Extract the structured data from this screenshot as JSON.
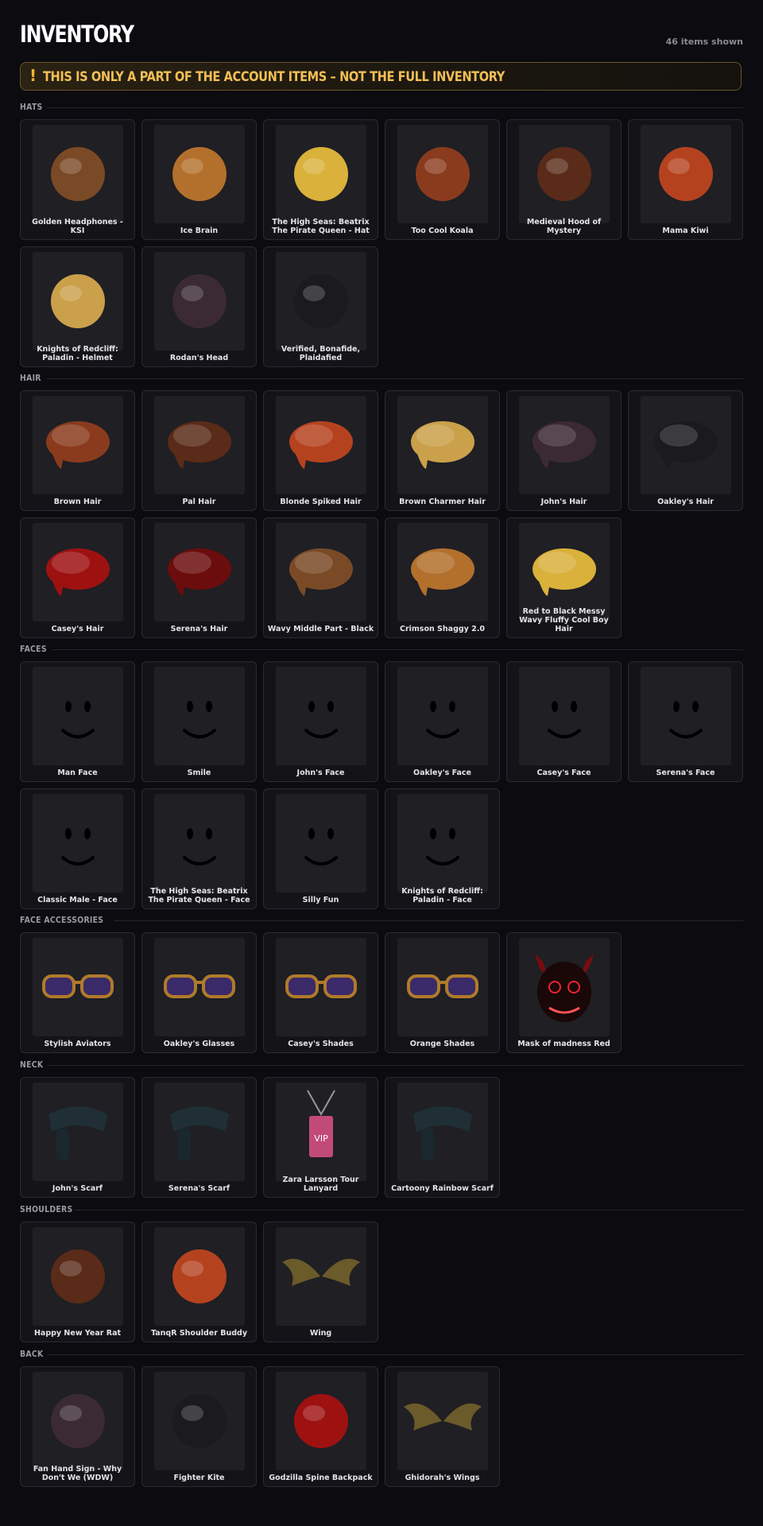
{
  "page": {
    "title": "INVENTORY",
    "count": "46 items shown"
  },
  "banner": {
    "icon": "!",
    "text": "THIS IS ONLY A PART OF THE ACCOUNT ITEMS – NOT THE FULL INVENTORY",
    "color": "#f3bf57"
  },
  "sections": [
    {
      "label": "HATS",
      "items": [
        {
          "name": "Golden Headphones - KSI",
          "icon": "headphones-icon"
        },
        {
          "name": "Ice Brain",
          "icon": "brain-icon"
        },
        {
          "name": "The High Seas: Beatrix The Pirate Queen - Hat",
          "icon": "pirate-hat-icon"
        },
        {
          "name": "Too Cool Koala",
          "icon": "koala-icon"
        },
        {
          "name": "Medieval Hood of Mystery",
          "icon": "hood-icon"
        },
        {
          "name": "Mama Kiwi",
          "icon": "kiwi-icon"
        },
        {
          "name": "Knights of Redcliff: Paladin - Helmet",
          "icon": "helmet-icon"
        },
        {
          "name": "Rodan's Head",
          "icon": "dragon-head-icon"
        },
        {
          "name": "Verified, Bonafide, Plaidafied",
          "icon": "plaid-cap-icon"
        }
      ]
    },
    {
      "label": "HAIR",
      "items": [
        {
          "name": "Brown Hair",
          "icon": "hair-icon"
        },
        {
          "name": "Pal Hair",
          "icon": "hair-icon"
        },
        {
          "name": "Blonde Spiked Hair",
          "icon": "hair-icon"
        },
        {
          "name": "Brown Charmer Hair",
          "icon": "hair-icon"
        },
        {
          "name": "John's Hair",
          "icon": "hair-icon"
        },
        {
          "name": "Oakley's Hair",
          "icon": "hair-icon"
        },
        {
          "name": "Casey's Hair",
          "icon": "hair-icon"
        },
        {
          "name": "Serena's Hair",
          "icon": "hair-icon"
        },
        {
          "name": "Wavy Middle Part - Black",
          "icon": "hair-icon"
        },
        {
          "name": "Crimson Shaggy 2.0",
          "icon": "hair-icon"
        },
        {
          "name": "Red to Black Messy Wavy Fluffy Cool Boy Hair",
          "icon": "hair-icon"
        }
      ]
    },
    {
      "label": "FACES",
      "items": [
        {
          "name": "Man Face",
          "icon": "face-icon"
        },
        {
          "name": "Smile",
          "icon": "face-icon"
        },
        {
          "name": "John's Face",
          "icon": "face-icon"
        },
        {
          "name": "Oakley's Face",
          "icon": "face-icon"
        },
        {
          "name": "Casey's Face",
          "icon": "face-icon"
        },
        {
          "name": "Serena's Face",
          "icon": "face-icon"
        },
        {
          "name": "Classic Male - Face",
          "icon": "face-icon"
        },
        {
          "name": "The High Seas: Beatrix The Pirate Queen - Face",
          "icon": "face-icon"
        },
        {
          "name": "Silly Fun",
          "icon": "face-icon"
        },
        {
          "name": "Knights of Redcliff: Paladin - Face",
          "icon": "face-icon"
        }
      ]
    },
    {
      "label": "FACE ACCESSORIES",
      "items": [
        {
          "name": "Stylish Aviators",
          "icon": "glasses-icon"
        },
        {
          "name": "Oakley's Glasses",
          "icon": "glasses-icon"
        },
        {
          "name": "Casey's Shades",
          "icon": "glasses-icon"
        },
        {
          "name": "Orange Shades",
          "icon": "glasses-icon"
        },
        {
          "name": "Mask of madness Red",
          "icon": "mask-icon"
        }
      ]
    },
    {
      "label": "NECK",
      "items": [
        {
          "name": "John's Scarf",
          "icon": "scarf-icon"
        },
        {
          "name": "Serena's Scarf",
          "icon": "scarf-icon"
        },
        {
          "name": "Zara Larsson Tour Lanyard",
          "icon": "lanyard-icon"
        },
        {
          "name": "Cartoony Rainbow Scarf",
          "icon": "scarf-icon"
        }
      ]
    },
    {
      "label": "SHOULDERS",
      "items": [
        {
          "name": "Happy New Year Rat",
          "icon": "rat-icon"
        },
        {
          "name": "TanqR Shoulder Buddy",
          "icon": "buddy-icon"
        },
        {
          "name": "Wing",
          "icon": "wings-icon"
        }
      ]
    },
    {
      "label": "BACK",
      "items": [
        {
          "name": "Fan Hand Sign - Why Don't We (WDW)",
          "icon": "foam-hand-icon"
        },
        {
          "name": "Fighter Kite",
          "icon": "kite-icon"
        },
        {
          "name": "Godzilla Spine Backpack",
          "icon": "backpack-icon"
        },
        {
          "name": "Ghidorah's Wings",
          "icon": "wings-icon"
        }
      ]
    }
  ]
}
